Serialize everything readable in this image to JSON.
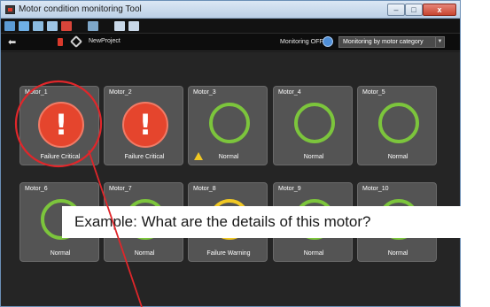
{
  "window": {
    "title": "Motor condition monitoring Tool",
    "min_glyph": "–",
    "max_glyph": "□",
    "close_glyph": "x"
  },
  "navbar": {
    "back_glyph": "⬅",
    "project_name": "NewProject",
    "monitoring_status": "Monitoring OFF",
    "monitoring_mode": "Monitoring by motor category",
    "dropdown_glyph": "▼"
  },
  "motors": [
    {
      "name": "Motor_1",
      "status": "Failure Critical",
      "state": "critical"
    },
    {
      "name": "Motor_2",
      "status": "Failure Critical",
      "state": "critical"
    },
    {
      "name": "Motor_3",
      "status": "Normal",
      "state": "normal",
      "warning_marker": true
    },
    {
      "name": "Motor_4",
      "status": "Normal",
      "state": "normal"
    },
    {
      "name": "Motor_5",
      "status": "Normal",
      "state": "normal"
    },
    {
      "name": "Motor_6",
      "status": "Normal",
      "state": "normal"
    },
    {
      "name": "Motor_7",
      "status": "Normal",
      "state": "normal"
    },
    {
      "name": "Motor_8",
      "status": "Failure Warning",
      "state": "warning"
    },
    {
      "name": "Motor_9",
      "status": "Normal",
      "state": "normal"
    },
    {
      "name": "Motor_10",
      "status": "Normal",
      "state": "normal"
    }
  ],
  "critical_glyph": "!",
  "annotation": {
    "text": "Example: What are the details of this motor?"
  },
  "colors": {
    "normal": "#7cc53c",
    "warning": "#f1c823",
    "critical": "#e5452d",
    "annotation": "#e0262a"
  }
}
